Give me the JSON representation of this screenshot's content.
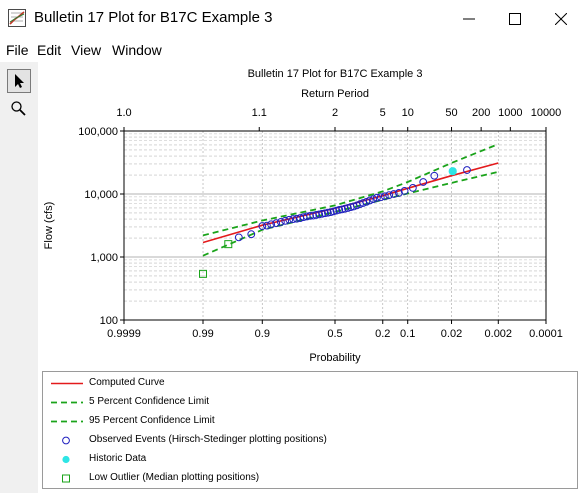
{
  "window": {
    "title": "Bulletin 17 Plot for B17C Example 3",
    "icon": "chart-app-icon",
    "controls": [
      "minimize-icon",
      "maximize-icon",
      "close-icon"
    ]
  },
  "menu": {
    "file": "File",
    "edit": "Edit",
    "view": "View",
    "window": "Window"
  },
  "toolbar": {
    "tools": [
      {
        "icon": "pointer-arrow-icon",
        "pressed": true
      },
      {
        "icon": "magnifier-icon",
        "pressed": false
      }
    ]
  },
  "chart_data": {
    "type": "scatter",
    "title": "Bulletin 17 Plot for B17C Example 3",
    "top_axis_label": "Return Period",
    "top_axis_ticks": [
      "1.0",
      "1.1",
      "2",
      "5",
      "10",
      "50",
      "200",
      "1000",
      "10000"
    ],
    "top_axis_tick_values": [
      1.0,
      1.1,
      2,
      5,
      10,
      50,
      200,
      1000,
      10000
    ],
    "xlabel": "Probability",
    "x_scale": "normal-probability",
    "x_ticks": [
      "0.9999",
      "0.99",
      "0.9",
      "0.5",
      "0.2",
      "0.1",
      "0.02",
      "0.002",
      "0.0001"
    ],
    "x_tick_values": [
      0.9999,
      0.99,
      0.9,
      0.5,
      0.2,
      0.1,
      0.02,
      0.002,
      0.0001
    ],
    "xlim": [
      0.9999,
      0.0001
    ],
    "ylabel": "Flow (cfs)",
    "y_scale": "log",
    "y_ticks": [
      "100",
      "1,000",
      "10,000",
      "100,000"
    ],
    "y_tick_values": [
      100,
      1000,
      10000,
      100000
    ],
    "ylim": [
      100,
      100000
    ],
    "grid": true,
    "series": [
      {
        "name": "Computed Curve",
        "kind": "line",
        "color": "#e31a1c",
        "dash": "solid",
        "x": [
          0.99,
          0.9,
          0.5,
          0.2,
          0.1,
          0.02,
          0.002
        ],
        "y": [
          1700,
          3200,
          5900,
          9400,
          12300,
          19500,
          31000
        ]
      },
      {
        "name": "5 Percent Confidence Limit",
        "kind": "line",
        "color": "#1aa31a",
        "dash": "dashed",
        "x": [
          0.99,
          0.9,
          0.5,
          0.2,
          0.1,
          0.02,
          0.002
        ],
        "y": [
          1050,
          2700,
          5200,
          8100,
          10200,
          15000,
          22500
        ]
      },
      {
        "name": "95 Percent Confidence Limit",
        "kind": "line",
        "color": "#1aa31a",
        "dash": "dashed",
        "x": [
          0.99,
          0.9,
          0.5,
          0.2,
          0.1,
          0.02,
          0.002
        ],
        "y": [
          2200,
          3800,
          6600,
          11000,
          15500,
          31000,
          62000
        ]
      },
      {
        "name": "Observed Events (Hirsch-Stedinger plotting positions)",
        "kind": "points",
        "marker": "open-circle",
        "color": "#1f1fbf",
        "x": [
          0.955,
          0.93,
          0.9,
          0.885,
          0.87,
          0.85,
          0.83,
          0.81,
          0.79,
          0.77,
          0.75,
          0.73,
          0.71,
          0.69,
          0.67,
          0.65,
          0.63,
          0.61,
          0.59,
          0.57,
          0.55,
          0.53,
          0.51,
          0.49,
          0.47,
          0.45,
          0.43,
          0.41,
          0.39,
          0.37,
          0.35,
          0.33,
          0.31,
          0.29,
          0.27,
          0.25,
          0.23,
          0.21,
          0.19,
          0.17,
          0.15,
          0.13,
          0.11,
          0.085,
          0.06,
          0.04,
          0.01
        ],
        "y": [
          2050,
          2300,
          3100,
          3150,
          3300,
          3450,
          3600,
          3750,
          3900,
          4000,
          4050,
          4150,
          4300,
          4400,
          4500,
          4550,
          4650,
          4750,
          4850,
          4950,
          5050,
          5150,
          5300,
          5450,
          5600,
          5700,
          5850,
          6000,
          6200,
          6350,
          6600,
          6900,
          7200,
          7500,
          7900,
          8300,
          8700,
          8900,
          9200,
          9600,
          10000,
          10400,
          11200,
          12500,
          15500,
          19500,
          24000
        ]
      },
      {
        "name": "Historic Data",
        "kind": "points",
        "marker": "filled-circle",
        "color": "#2ee5e5",
        "x": [
          0.019
        ],
        "y": [
          23000
        ]
      },
      {
        "name": "Low Outlier (Median plotting positions)",
        "kind": "points",
        "marker": "open-square",
        "color": "#1aa31a",
        "x": [
          0.99,
          0.97
        ],
        "y": [
          540,
          1600
        ]
      }
    ]
  }
}
